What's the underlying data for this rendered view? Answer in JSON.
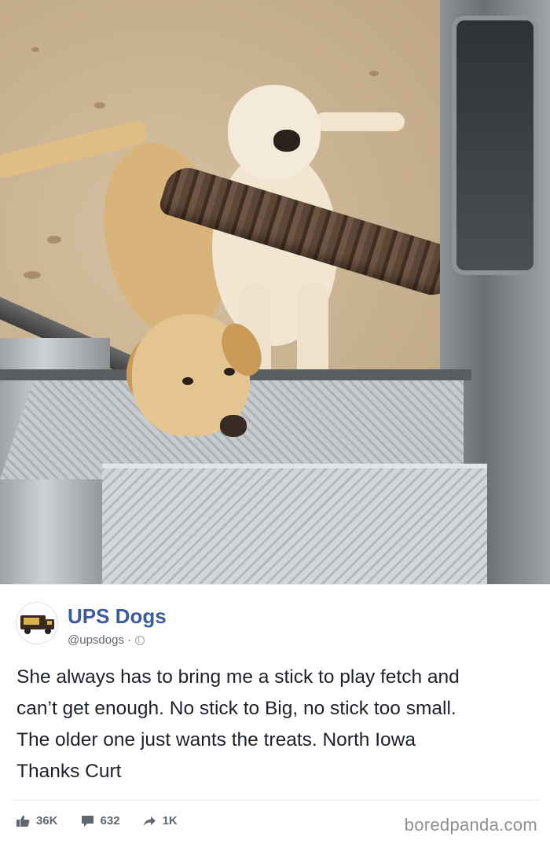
{
  "photo": {
    "subject": "dog-photo"
  },
  "post": {
    "page_name": "UPS Dogs",
    "handle": "@upsdogs",
    "separator": "·",
    "text_lines": [
      "She always has to bring me a stick to play fetch and",
      "can’t get enough. No stick to Big, no stick too small.",
      "The older one just wants the treats. North Iowa",
      "Thanks Curt"
    ],
    "stats": {
      "likes": "36K",
      "comments": "632",
      "shares": "1K"
    }
  },
  "watermark": "boredpanda.com",
  "colors": {
    "page_name": "#3b5b9a",
    "body_text": "#1d2129",
    "meta_text": "#616770",
    "stats_text": "#606770",
    "watermark": "#8d8f93"
  },
  "icons": {
    "avatar": "ups-truck-icon",
    "privacy": "globe-icon",
    "likes": "thumbs-up-icon",
    "comments": "comment-icon",
    "shares": "share-arrow-icon"
  }
}
